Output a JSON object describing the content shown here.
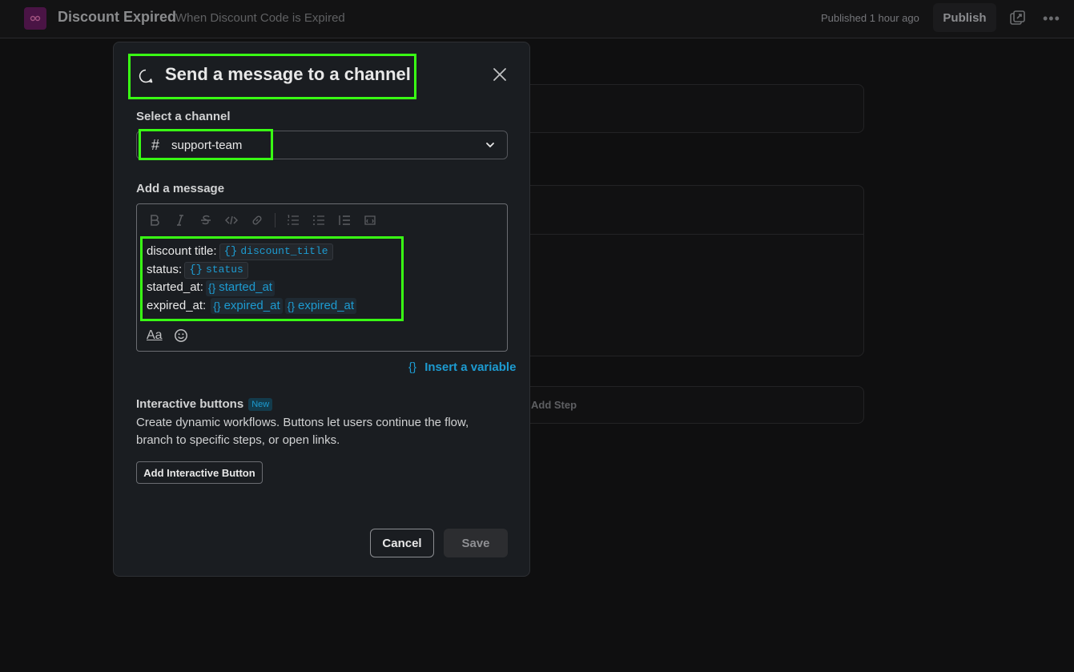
{
  "header": {
    "title": "Discount Expired",
    "subtitle": "When Discount Code is Expired",
    "published": "Published 1 hour ago",
    "publish_label": "Publish"
  },
  "canvas": {
    "add_step_label": "Add Step"
  },
  "modal": {
    "title": "Send a message to a channel",
    "channel_label": "Select a channel",
    "channel_hash": "#",
    "channel_value": "support-team",
    "message_label": "Add a message",
    "message": {
      "line1_label": "discount title:",
      "line1_var": "discount_title",
      "line2_label": "status:",
      "line2_var": "status",
      "line3_label": "started_at:",
      "line3_var": "started_at",
      "line4_label": "expired_at:",
      "line4_var1": "expired_at",
      "line4_var2": "expired_at",
      "brace": "{}"
    },
    "format_label": "Aa",
    "insert_variable": "Insert a variable",
    "interactive_title": "Interactive buttons",
    "new_badge": "New",
    "interactive_desc": "Create dynamic workflows. Buttons let users continue the flow, branch to specific steps, or open links.",
    "add_button_label": "Add Interactive Button",
    "cancel_label": "Cancel",
    "save_label": "Save"
  },
  "colors": {
    "highlight": "#39ff14",
    "link": "#1d9bd1",
    "app_icon_bg": "#4a1445"
  }
}
